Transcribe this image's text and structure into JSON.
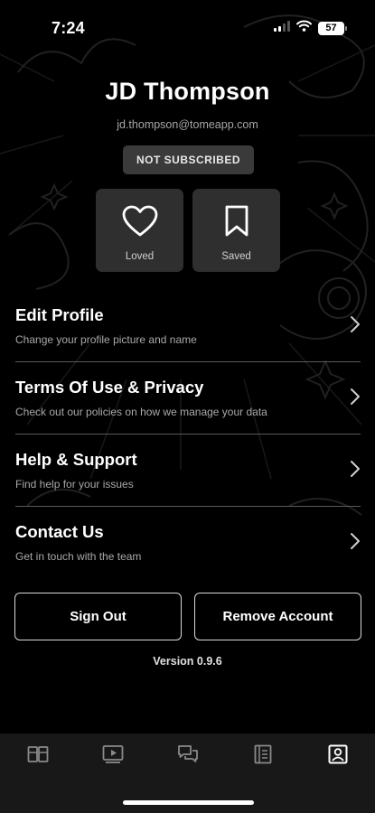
{
  "status_bar": {
    "time": "7:24",
    "battery": "57",
    "icons": [
      "signal-icon",
      "wifi-icon",
      "battery-icon"
    ]
  },
  "profile": {
    "name": "JD Thompson",
    "email": "jd.thompson@tomeapp.com",
    "subscription_badge": "NOT SUBSCRIBED"
  },
  "tiles": [
    {
      "label": "Loved",
      "icon": "heart-icon"
    },
    {
      "label": "Saved",
      "icon": "bookmark-icon"
    }
  ],
  "menu": [
    {
      "title": "Edit Profile",
      "description": "Change your profile picture and name"
    },
    {
      "title": "Terms Of Use & Privacy",
      "description": "Check out our policies on how we manage your data"
    },
    {
      "title": "Help & Support",
      "description": "Find help for your issues"
    },
    {
      "title": "Contact Us",
      "description": "Get in touch with the team"
    }
  ],
  "actions": {
    "sign_out": "Sign Out",
    "remove_account": "Remove Account"
  },
  "version": "Version 0.9.6",
  "tab_bar": {
    "icons": [
      "library-icon",
      "video-icon",
      "chat-icon",
      "notes-icon",
      "profile-icon"
    ],
    "active": "profile-icon"
  },
  "colors": {
    "background": "#000000",
    "tile": "#2f2f2f",
    "badge": "#3a3a3a",
    "tab_bar": "#181818",
    "divider": "#5a5a5a"
  }
}
